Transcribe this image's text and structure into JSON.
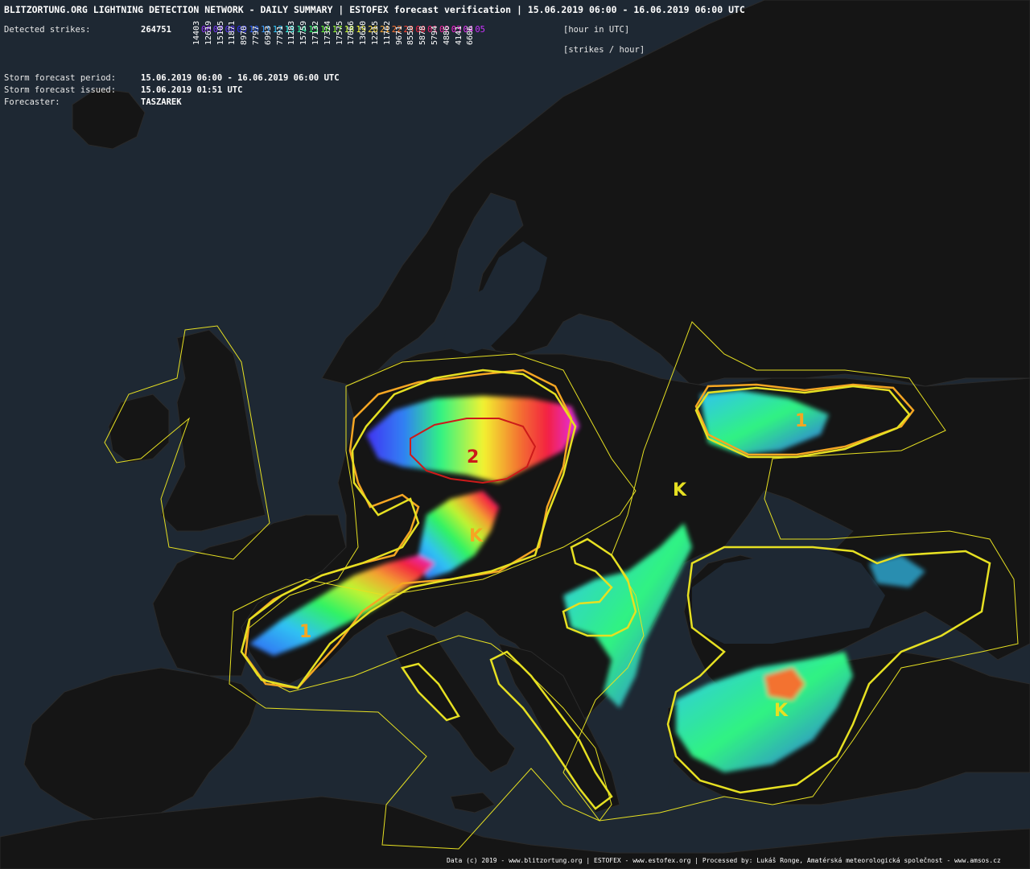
{
  "header": {
    "title": "BLITZORTUNG.ORG LIGHTNING DETECTION NETWORK - DAILY SUMMARY | ESTOFEX forecast verification | 15.06.2019 06:00 - 16.06.2019 06:00 UTC",
    "detected_label": "Detected strikes:",
    "detected_value": "264751",
    "hour_unit": "[hour in UTC]",
    "strike_unit": "[strikes / hour]",
    "period_label": "Storm forecast period:",
    "period_value": "15.06.2019 06:00 - 16.06.2019 06:00 UTC",
    "issued_label": "Storm forecast issued:",
    "issued_value": "15.06.2019 01:51 UTC",
    "forecaster_label": "Forecaster:",
    "forecaster_value": "TASZAREK"
  },
  "hours": [
    {
      "h": "06",
      "color": "#9933ff"
    },
    {
      "h": "07",
      "color": "#7a33ff"
    },
    {
      "h": "08",
      "color": "#5c33ff"
    },
    {
      "h": "09",
      "color": "#3333ff"
    },
    {
      "h": "10",
      "color": "#3366ff"
    },
    {
      "h": "11",
      "color": "#3399ff"
    },
    {
      "h": "12",
      "color": "#33ccff"
    },
    {
      "h": "13",
      "color": "#33ffee"
    },
    {
      "h": "14",
      "color": "#33ffaa"
    },
    {
      "h": "15",
      "color": "#33ff66"
    },
    {
      "h": "16",
      "color": "#66ff33"
    },
    {
      "h": "17",
      "color": "#99ff33"
    },
    {
      "h": "18",
      "color": "#ccff33"
    },
    {
      "h": "19",
      "color": "#ffff33"
    },
    {
      "h": "20",
      "color": "#ffdd33"
    },
    {
      "h": "21",
      "color": "#ffaa33"
    },
    {
      "h": "22",
      "color": "#ff7733"
    },
    {
      "h": "23",
      "color": "#ff4433"
    },
    {
      "h": "00",
      "color": "#ff2244"
    },
    {
      "h": "01",
      "color": "#ff2277"
    },
    {
      "h": "02",
      "color": "#ff22aa"
    },
    {
      "h": "03",
      "color": "#ff22dd"
    },
    {
      "h": "04",
      "color": "#ee33ff"
    },
    {
      "h": "05",
      "color": "#cc33ff"
    }
  ],
  "strike_counts": [
    "14403",
    "12619",
    "15105",
    "11871",
    "8970",
    "7797",
    "6993",
    "7791",
    "11283",
    "15759",
    "17132",
    "17324",
    "17575",
    "17066",
    "13620",
    "12215",
    "11762",
    "9671",
    "8550",
    "5878",
    "5794",
    "4886",
    "4141",
    "6606"
  ],
  "forecast_labels": [
    {
      "text": "1",
      "level": "1"
    },
    {
      "text": "2",
      "level": "2"
    },
    {
      "text": "K",
      "level": "1"
    },
    {
      "text": "K",
      "level": "0"
    },
    {
      "text": "1",
      "level": "1"
    },
    {
      "text": "1",
      "level": "1"
    },
    {
      "text": "K",
      "level": "0"
    }
  ],
  "colors": {
    "background": "#1e2833",
    "land": "#141414",
    "level0": "#e6e022",
    "level1": "#f5a623",
    "level2": "#cc1a1a"
  },
  "footer": "Data (c) 2019 - www.blitzortung.org | ESTOFEX - www.estofex.org | Processed by: Lukáš Ronge, Amatérská meteorologická společnost - www.amsos.cz"
}
